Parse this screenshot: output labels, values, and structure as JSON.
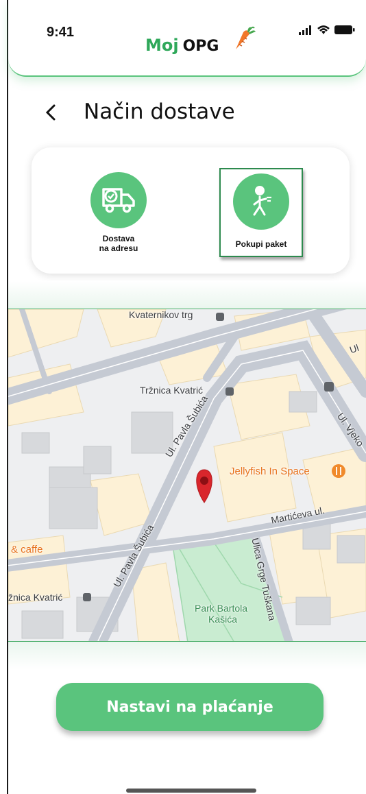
{
  "status_bar": {
    "time": "9:41",
    "icons": [
      "signal-icon",
      "wifi-icon",
      "battery-icon"
    ]
  },
  "header": {
    "brand_part1": "Moj",
    "brand_part2": "OPG",
    "logo_icon": "carrot-icon"
  },
  "page": {
    "title": "Način dostave",
    "back_icon": "chevron-left-icon"
  },
  "delivery_options": [
    {
      "label_line1": "Dostava",
      "label_line2": "na adresu",
      "icon": "delivery-truck-icon",
      "selected": false
    },
    {
      "label_line1": "Pokupi paket",
      "label_line2": "",
      "icon": "walking-person-icon",
      "selected": true
    }
  ],
  "map": {
    "labels": {
      "kvaternikov": "Kvaternikov trg",
      "trznica": "Tržnica Kvatrić",
      "pavla1": "Ul. Pavla Šubića",
      "pavla2": "Ul. Pavla Šubića",
      "jellyfish": "Jellyfish In Space",
      "marticeva": "Martićeva ul.",
      "caffe": "& caffe",
      "trznica2": "žnica Kvatrić",
      "ulica_grge": "Ulica Grge Tuškana",
      "park1": "Park Bartola",
      "park2": "Kašića",
      "ul_vjeko": "Ul. Vjeko",
      "ul_top": "Ul"
    },
    "pin_icon": "map-pin-icon"
  },
  "cta": {
    "label": "Nastavi na plaćanje"
  },
  "colors": {
    "accent": "#5ac47d",
    "accent_dark": "#2fa85a",
    "selected_border": "#2d8a4e"
  }
}
